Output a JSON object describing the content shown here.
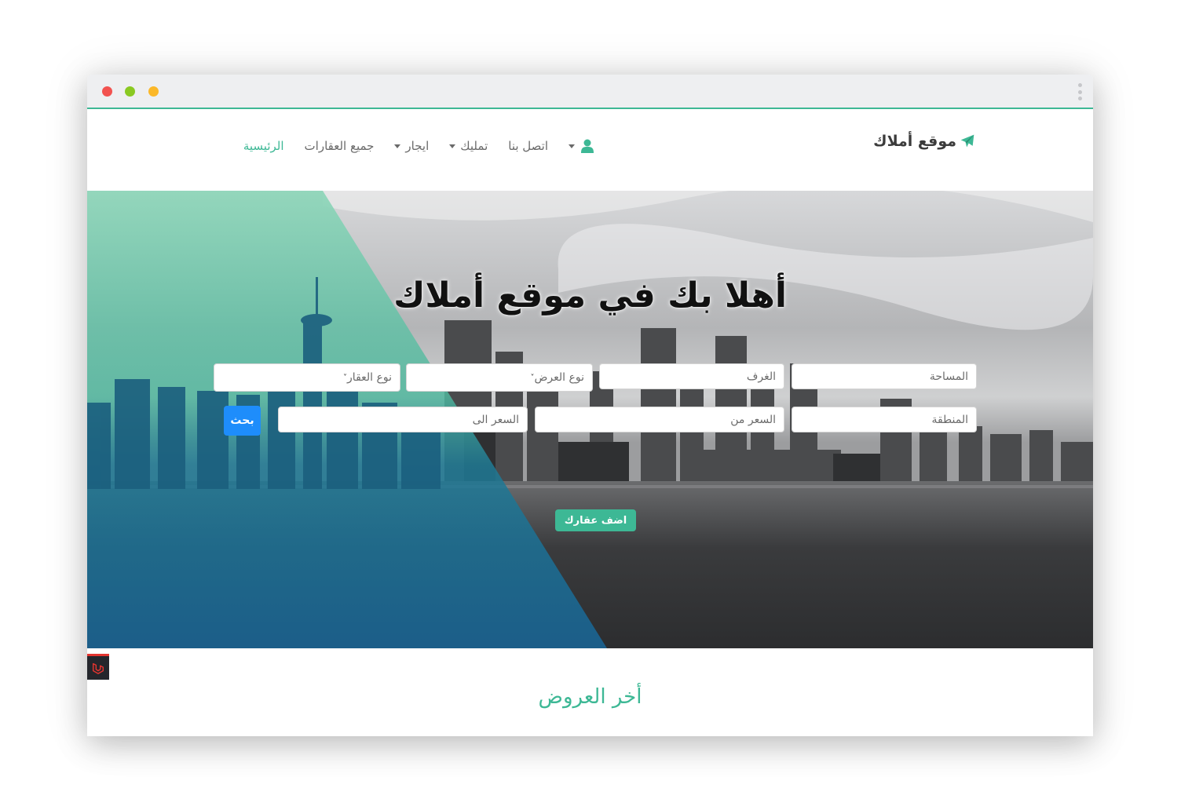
{
  "colors": {
    "accent": "#3db895",
    "primary_button": "#1e8dfb",
    "nav_text": "#6a6a6a",
    "hero_overlay": "#3db895",
    "window_dots": [
      "#f2524f",
      "#8ac922",
      "#fbb829"
    ]
  },
  "navbar": {
    "brand_icon": "paper-plane-icon",
    "brand": "موقع أملاك",
    "items": [
      {
        "label": "الرئيسية",
        "active": true,
        "dropdown": false
      },
      {
        "label": "جميع العقارات",
        "active": false,
        "dropdown": false
      },
      {
        "label": "ايجار",
        "active": false,
        "dropdown": true
      },
      {
        "label": "تمليك",
        "active": false,
        "dropdown": true
      },
      {
        "label": "اتصل بنا",
        "active": false,
        "dropdown": false
      }
    ],
    "user_icon": "user-icon"
  },
  "hero": {
    "title": "أهلا بك في موقع أملاك",
    "search": {
      "area_placeholder": "المساحة",
      "rooms_placeholder": "الغرف",
      "offer_type": "نوع العرض",
      "property_type": "نوع العقار",
      "region_placeholder": "المنطقة",
      "price_from_placeholder": "السعر من",
      "price_to_placeholder": "السعر الى",
      "search_button": "بحث"
    },
    "add_property_button": "اضف عقارك"
  },
  "latest_offers": {
    "title": "أخر العروض"
  }
}
